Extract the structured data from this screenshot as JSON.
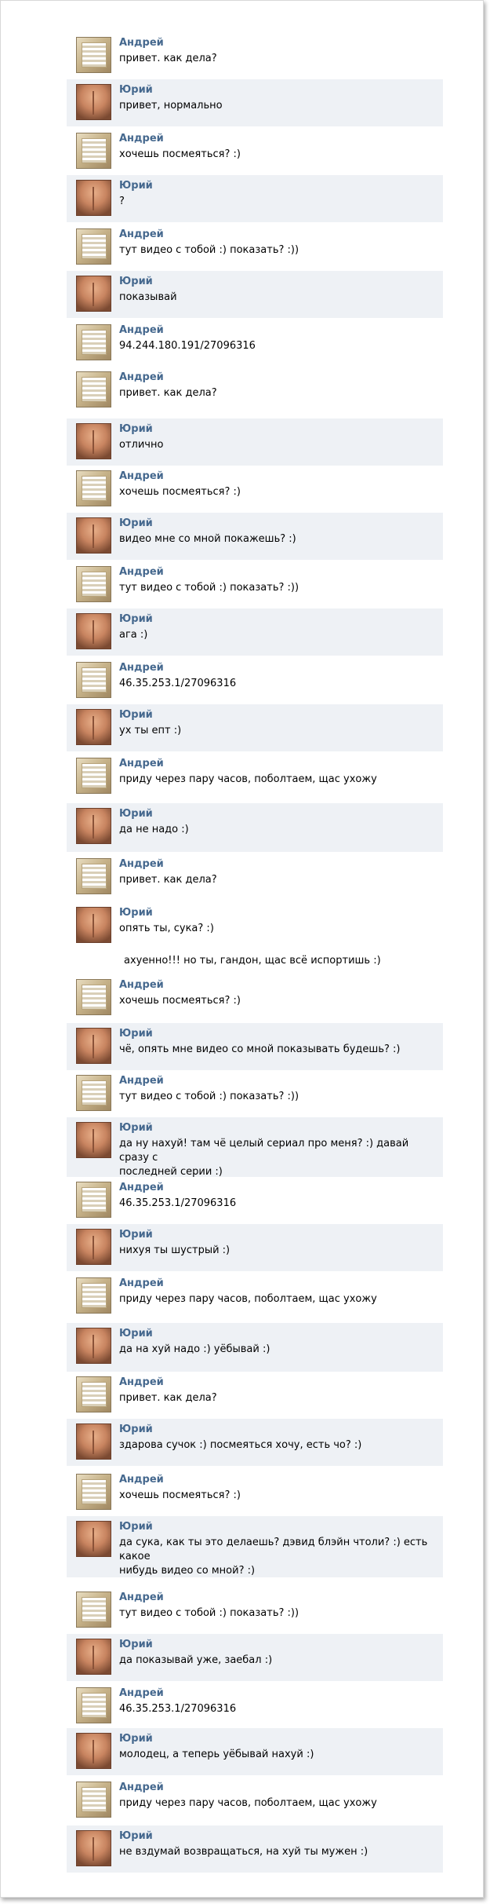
{
  "colors": {
    "name": "#45688e",
    "alt_bg": "#eef1f5"
  },
  "messages": [
    {
      "from": "Андрей",
      "avatar": "andrey-avatar",
      "text": [
        "привет. как дела?"
      ],
      "alt": false
    },
    {
      "from": "Юрий",
      "avatar": "yuri-avatar",
      "text": [
        "привет, нормально"
      ],
      "alt": true
    },
    {
      "from": "Андрей",
      "avatar": "andrey-avatar",
      "text": [
        "хочешь посмеяться? :)"
      ],
      "alt": false
    },
    {
      "from": "Юрий",
      "avatar": "yuri-avatar",
      "text": [
        "?"
      ],
      "alt": true
    },
    {
      "from": "Андрей",
      "avatar": "andrey-avatar",
      "text": [
        "тут видео с тобой :) показать? :))"
      ],
      "alt": false
    },
    {
      "from": "Юрий",
      "avatar": "yuri-avatar",
      "text": [
        "показывай"
      ],
      "alt": true
    },
    {
      "from": "Андрей",
      "avatar": "andrey-avatar",
      "text": [
        "94.244.180.191/27096316"
      ],
      "alt": false
    },
    {
      "from": "Андрей",
      "avatar": "andrey-avatar",
      "text": [
        "привет. как дела?"
      ],
      "alt": false
    },
    {
      "from": "Юрий",
      "avatar": "yuri-avatar",
      "text": [
        "отлично"
      ],
      "alt": true
    },
    {
      "from": "Андрей",
      "avatar": "andrey-avatar",
      "text": [
        "хочешь посмеяться? :)"
      ],
      "alt": false
    },
    {
      "from": "Юрий",
      "avatar": "yuri-avatar",
      "text": [
        "видео мне со мной покажешь? :)"
      ],
      "alt": true
    },
    {
      "from": "Андрей",
      "avatar": "andrey-avatar",
      "text": [
        "тут видео с тобой :) показать? :))"
      ],
      "alt": false
    },
    {
      "from": "Юрий",
      "avatar": "yuri-avatar",
      "text": [
        "ага :)"
      ],
      "alt": true
    },
    {
      "from": "Андрей",
      "avatar": "andrey-avatar",
      "text": [
        "46.35.253.1/27096316"
      ],
      "alt": false
    },
    {
      "from": "Юрий",
      "avatar": "yuri-avatar",
      "text": [
        "ух ты епт :)"
      ],
      "alt": true
    },
    {
      "from": "Андрей",
      "avatar": "andrey-avatar",
      "text": [
        "приду через пару часов, поболтаем, щас ухожу"
      ],
      "alt": false
    },
    {
      "from": "Юрий",
      "avatar": "yuri-avatar",
      "text": [
        "да не надо :)"
      ],
      "alt": true
    },
    {
      "from": "Андрей",
      "avatar": "andrey-avatar",
      "text": [
        "привет. как дела?"
      ],
      "alt": false
    },
    {
      "from": "Юрий",
      "avatar": "yuri-avatar",
      "text": [
        "опять ты, сука? :)"
      ],
      "alt": false
    },
    {
      "from": "Андрей",
      "avatar": "andrey-avatar",
      "text": [
        "хочешь посмеяться? :)"
      ],
      "alt": false
    },
    {
      "from": "Юрий",
      "avatar": "yuri-avatar",
      "text": [
        "чё, опять мне видео со мной показывать будешь? :)"
      ],
      "alt": true
    },
    {
      "from": "Андрей",
      "avatar": "andrey-avatar",
      "text": [
        "тут видео с тобой :) показать? :))"
      ],
      "alt": false
    },
    {
      "from": "Юрий",
      "avatar": "yuri-avatar",
      "text": [
        "да ну нахуй! там чё целый сериал про меня? :) давай сразу с",
        "последней серии :)"
      ],
      "alt": true
    },
    {
      "from": "Андрей",
      "avatar": "andrey-avatar",
      "text": [
        "46.35.253.1/27096316"
      ],
      "alt": false
    },
    {
      "from": "Юрий",
      "avatar": "yuri-avatar",
      "text": [
        "нихуя ты шустрый :)"
      ],
      "alt": true
    },
    {
      "from": "Андрей",
      "avatar": "andrey-avatar",
      "text": [
        "приду через пару часов, поболтаем, щас ухожу"
      ],
      "alt": false
    },
    {
      "from": "Юрий",
      "avatar": "yuri-avatar",
      "text": [
        "да на хуй надо :) уёбывай :)"
      ],
      "alt": true
    },
    {
      "from": "Андрей",
      "avatar": "andrey-avatar",
      "text": [
        "привет. как дела?"
      ],
      "alt": false
    },
    {
      "from": "Юрий",
      "avatar": "yuri-avatar",
      "text": [
        "здарова сучок :) посмеяться хочу, есть чо? :)"
      ],
      "alt": true
    },
    {
      "from": "Андрей",
      "avatar": "andrey-avatar",
      "text": [
        "хочешь посмеяться? :)"
      ],
      "alt": false
    },
    {
      "from": "Юрий",
      "avatar": "yuri-avatar",
      "text": [
        "да сука, как ты это делаешь? дэвид блэйн чтоли? :) есть какое",
        "нибудь видео со мной? :)"
      ],
      "alt": true
    },
    {
      "from": "Андрей",
      "avatar": "andrey-avatar",
      "text": [
        "тут видео с тобой :) показать? :))"
      ],
      "alt": false
    },
    {
      "from": "Юрий",
      "avatar": "yuri-avatar",
      "text": [
        "да показывай уже, заебал :)"
      ],
      "alt": true
    },
    {
      "from": "Андрей",
      "avatar": "andrey-avatar",
      "text": [
        "46.35.253.1/27096316"
      ],
      "alt": false
    },
    {
      "from": "Юрий",
      "avatar": "yuri-avatar",
      "text": [
        "молодец, а теперь уёбывай нахуй :)"
      ],
      "alt": true
    },
    {
      "from": "Андрей",
      "avatar": "andrey-avatar",
      "text": [
        "приду через пару часов, поболтаем, щас ухожу"
      ],
      "alt": false
    },
    {
      "from": "Юрий",
      "avatar": "yuri-avatar",
      "text": [
        "не вздумай возвращаться, на хуй ты мужен :)"
      ],
      "alt": true
    }
  ],
  "extra_line": "ахуенно!!! но ты, гандон, щас всё испортишь :)"
}
